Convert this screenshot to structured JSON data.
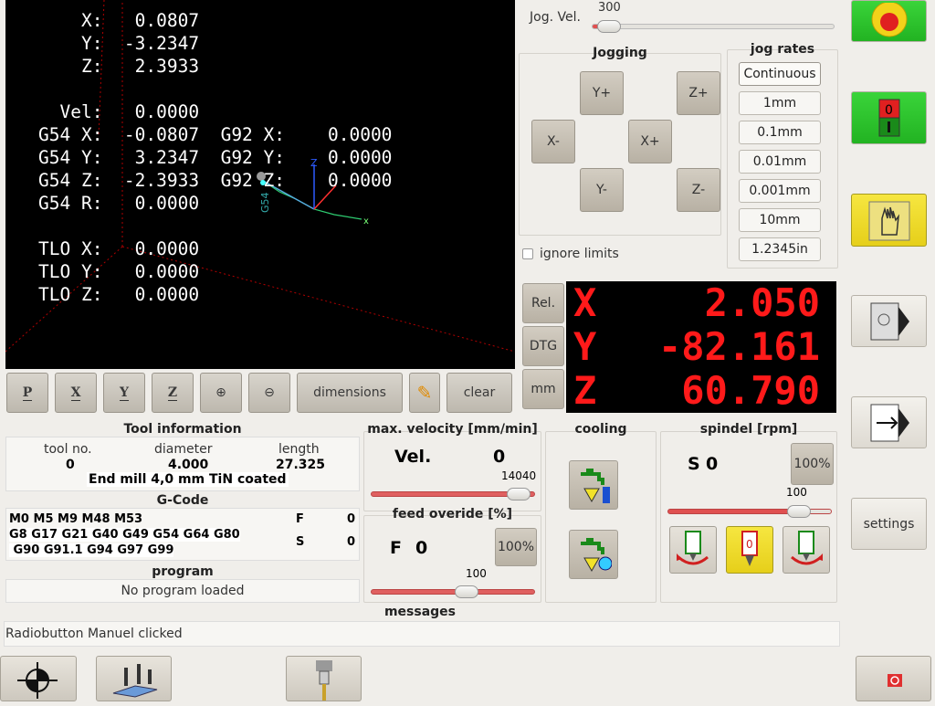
{
  "view": {
    "lines": [
      "    X:   0.0807",
      "    Y:  -3.2347",
      "    Z:   2.3933",
      "",
      "  Vel:   0.0000",
      "G54 X:  -0.0807  G92 X:    0.0000",
      "G54 Y:   3.2347  G92 Y:    0.0000",
      "G54 Z:  -2.3933  G92 Z:    0.0000",
      "G54 R:   0.0000",
      "",
      "TLO X:   0.0000",
      "TLO Y:   0.0000",
      "TLO Z:   0.0000"
    ],
    "axis_label": "G54",
    "z_label": "Z"
  },
  "toolbar": {
    "p": "P",
    "x": "X",
    "y": "Y",
    "z": "Z",
    "dimensions": "dimensions",
    "clear": "clear"
  },
  "jog": {
    "vel_label": "Jog. Vel.",
    "vel_value": "300",
    "jogging_title": "Jogging",
    "rates_title": "jog rates",
    "buttons": {
      "yplus": "Y+",
      "zplus": "Z+",
      "xminus": "X-",
      "xplus": "X+",
      "yminus": "Y-",
      "zminus": "Z-"
    },
    "rates": [
      "Continuous",
      "1mm",
      "0.1mm",
      "0.01mm",
      "0.001mm",
      "10mm",
      "1.2345in"
    ],
    "ignore_limits": "ignore limits"
  },
  "dro": {
    "mode_buttons": [
      "Rel.",
      "DTG",
      "mm"
    ],
    "axes": [
      {
        "axis": "X",
        "value": "2.050"
      },
      {
        "axis": "Y",
        "value": "-82.161"
      },
      {
        "axis": "Z",
        "value": "60.790"
      }
    ]
  },
  "tool": {
    "title": "Tool information",
    "headers": [
      "tool no.",
      "diameter",
      "length"
    ],
    "values": [
      "0",
      "4.000",
      "27.325"
    ],
    "description": "End mill 4,0 mm TiN coated"
  },
  "gcode": {
    "title": "G-Code",
    "line1": "M0 M5 M9 M48 M53",
    "line2": "G8 G17 G21 G40 G49 G54 G64 G80",
    "line3": " G90 G91.1 G94 G97 G99",
    "f_label": "F",
    "f_value": "0",
    "s_label": "S",
    "s_value": "0"
  },
  "program": {
    "title": "program",
    "status": "No program loaded"
  },
  "velocity": {
    "title": "max. velocity [mm/min]",
    "label": "Vel.",
    "value": "0",
    "max": "14040",
    "slider_fraction": 0.97
  },
  "feed": {
    "title": "feed overide [%]",
    "label": "F",
    "value": "0",
    "reset": "100%",
    "slider_value": "100",
    "slider_fraction": 0.6
  },
  "cooling": {
    "title": "cooling"
  },
  "spindle": {
    "title": "spindel [rpm]",
    "label": "S",
    "value": "0",
    "reset": "100%",
    "slider_value": "100",
    "slider_fraction": 0.85
  },
  "messages": {
    "title": "messages",
    "text": "Radiobutton Manuel clicked"
  },
  "side": {
    "settings": "settings"
  },
  "colors": {
    "dro_red": "#ff1a1a",
    "estop_green": "#2fd12f",
    "machine_yellow": "#f2e22a"
  }
}
